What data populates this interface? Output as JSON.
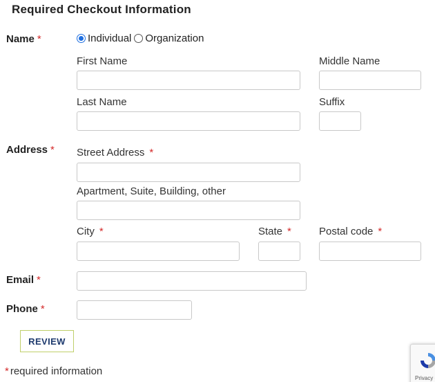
{
  "heading": "Required Checkout Information",
  "required_marker": "*",
  "name": {
    "label": "Name",
    "radio_options": [
      {
        "label": "Individual",
        "checked": true
      },
      {
        "label": "Organization",
        "checked": false
      }
    ],
    "first_name": {
      "label": "First Name",
      "value": ""
    },
    "middle_name": {
      "label": "Middle Name",
      "value": ""
    },
    "last_name": {
      "label": "Last Name",
      "value": ""
    },
    "suffix": {
      "label": "Suffix",
      "value": ""
    }
  },
  "address": {
    "label": "Address",
    "street": {
      "label": "Street Address",
      "value": ""
    },
    "apartment": {
      "label": "Apartment, Suite, Building, other",
      "value": ""
    },
    "city": {
      "label": "City",
      "value": ""
    },
    "state": {
      "label": "State",
      "value": ""
    },
    "postal_code": {
      "label": "Postal code",
      "value": ""
    }
  },
  "email": {
    "label": "Email",
    "value": ""
  },
  "phone": {
    "label": "Phone",
    "value": ""
  },
  "review_button": "REVIEW",
  "required_note": {
    "star": "*",
    "text": "required information"
  },
  "recaptcha": {
    "text": "Privacy - Terms",
    "icon": "recaptcha-icon"
  },
  "colors": {
    "required": "#d42a2a",
    "radio_accent": "#1f6fe0",
    "button_border": "#bfcf6a",
    "button_text": "#1e3a6e"
  }
}
